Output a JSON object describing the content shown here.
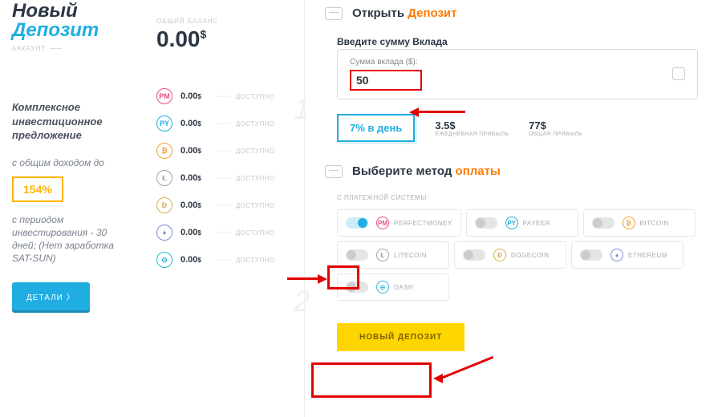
{
  "header": {
    "title_line1": "Новый",
    "title_line2": "Депозит",
    "account": "АККАУНТ"
  },
  "promo": {
    "title": "Комплексное инвестиционное предложение",
    "sub": "с общим доходом до",
    "percent": "154%",
    "period": "с периодом инвестирования - 30 дней; (Нет заработка SAT-SUN)",
    "details_btn": "ДЕТАЛИ  〉"
  },
  "balance": {
    "label": "ОБЩИЙ БАЛАНС",
    "amount": "0.00",
    "currency": "$"
  },
  "coins": [
    {
      "sym": "PM",
      "color": "#e84d8a",
      "val": "0.00",
      "status": "ДОСТУПНО"
    },
    {
      "sym": "PY",
      "color": "#20aee2",
      "val": "0.00",
      "status": "ДОСТУПНО"
    },
    {
      "sym": "₿",
      "color": "#f0a030",
      "val": "0.00",
      "status": "ДОСТУПНО"
    },
    {
      "sym": "Ł",
      "color": "#9aa3ad",
      "val": "0.00",
      "status": "ДОСТУПНО"
    },
    {
      "sym": "Ð",
      "color": "#d4b050",
      "val": "0.00",
      "status": "ДОСТУПНО"
    },
    {
      "sym": "♦",
      "color": "#7b8cd8",
      "val": "0.00",
      "status": "ДОСТУПНО"
    },
    {
      "sym": "⊖",
      "color": "#30b8d4",
      "val": "0.00",
      "status": "ДОСТУПНО"
    }
  ],
  "open": {
    "title_pre": "Открыть ",
    "title_acc": "Депозит",
    "input_heading": "Введите сумму Вклада",
    "legend": "Сумма вклада ($):",
    "value": "50",
    "rate": "7% в день",
    "daily_val": "3.5$",
    "daily_lbl": "ЕЖЕДНЕВНАЯ ПРИБЫЛЬ",
    "total_val": "77$",
    "total_lbl": "ОБЩАЯ ПРИБЫЛЬ"
  },
  "pay": {
    "title_pre": "Выберите метод ",
    "title_acc": "оплаты",
    "from_label": "С ПЛАТЕЖНОЙ СИСТЕМЫ:",
    "methods": [
      {
        "sym": "PM",
        "color": "#e84d8a",
        "name": "PERFECTMONEY",
        "on": true
      },
      {
        "sym": "PY",
        "color": "#20aee2",
        "name": "PAYEER",
        "on": false
      },
      {
        "sym": "₿",
        "color": "#f0a030",
        "name": "BITCOIN",
        "on": false
      },
      {
        "sym": "Ł",
        "color": "#9aa3ad",
        "name": "LITECOIN",
        "on": false
      },
      {
        "sym": "Ð",
        "color": "#d4b050",
        "name": "DOGECOIN",
        "on": false
      },
      {
        "sym": "♦",
        "color": "#7b8cd8",
        "name": "ETHEREUM",
        "on": false
      },
      {
        "sym": "⊖",
        "color": "#30b8d4",
        "name": "DASH",
        "on": false
      }
    ],
    "submit": "НОВЫЙ ДЕПОЗИТ"
  }
}
